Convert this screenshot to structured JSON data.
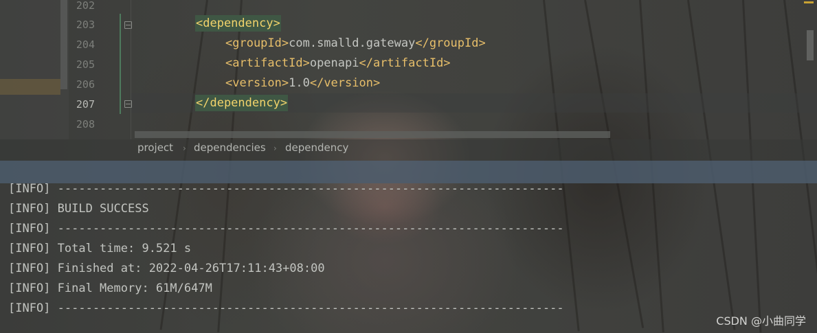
{
  "editor": {
    "line_numbers": [
      "202",
      "203",
      "204",
      "205",
      "206",
      "207",
      "208"
    ],
    "code": {
      "line203_tag": "<dependency>",
      "line204_open": "<groupId>",
      "line204_text": "com.smalld.gateway",
      "line204_close": "</groupId>",
      "line205_open": "<artifactId>",
      "line205_text": "openapi",
      "line205_close": "</artifactId>",
      "line206_open": "<version>",
      "line206_text": "1.0",
      "line206_close": "</version>",
      "line207_tag": "</dependency>"
    }
  },
  "breadcrumb": {
    "items": [
      "project",
      "dependencies",
      "dependency"
    ],
    "separator": "›"
  },
  "console": {
    "lines": [
      "[INFO] ------------------------------------------------------------------------",
      "[INFO] BUILD SUCCESS",
      "[INFO] ------------------------------------------------------------------------",
      "[INFO] Total time: 9.521 s",
      "[INFO] Finished at: 2022-04-26T17:11:43+08:00",
      "[INFO] Final Memory: 61M/647M",
      "[INFO] ------------------------------------------------------------------------"
    ]
  },
  "watermark": "CSDN @小曲同学",
  "colors": {
    "tag": "#e8bf6a",
    "matched_tag_bg": "#3f5744",
    "text": "#c4c6c2",
    "panel_divider": "#4c5c6c"
  }
}
